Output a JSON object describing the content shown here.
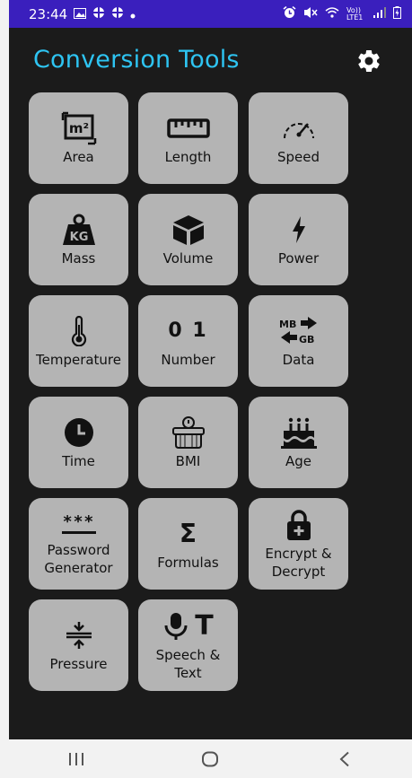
{
  "status_bar": {
    "time": "23:44",
    "network": "Vo)) LTE1"
  },
  "header": {
    "title": "Conversion Tools"
  },
  "tiles": [
    {
      "label": "Area",
      "icon": "area-icon"
    },
    {
      "label": "Length",
      "icon": "ruler-icon"
    },
    {
      "label": "Speed",
      "icon": "speedometer-icon"
    },
    {
      "label": "Mass",
      "icon": "kg-weight-icon"
    },
    {
      "label": "Volume",
      "icon": "cube-icon"
    },
    {
      "label": "Power",
      "icon": "lightning-icon"
    },
    {
      "label": "Temperature",
      "icon": "thermometer-icon"
    },
    {
      "label": "Number",
      "icon": "number-icon",
      "icon_text": "0 1"
    },
    {
      "label": "Data",
      "icon": "data-transfer-icon",
      "icon_text_top": "MB",
      "icon_text_bottom": "GB"
    },
    {
      "label": "Time",
      "icon": "clock-icon"
    },
    {
      "label": "BMI",
      "icon": "scale-icon"
    },
    {
      "label": "Age",
      "icon": "birthday-cake-icon"
    },
    {
      "label": "Password\nGenerator",
      "icon": "password-icon",
      "icon_text": "***"
    },
    {
      "label": "Formulas",
      "icon": "sigma-icon",
      "icon_text": "Σ"
    },
    {
      "label": "Encrypt &\nDecrypt",
      "icon": "lock-icon"
    },
    {
      "label": "Pressure",
      "icon": "compress-icon"
    },
    {
      "label": "Speech &\nText",
      "icon": "mic-text-icon",
      "icon_text": "T"
    }
  ],
  "colors": {
    "title": "#2ec4f2",
    "background": "#1b1b1b",
    "tile": "#b4b4b4",
    "status_bar": "#3a1fbd"
  }
}
